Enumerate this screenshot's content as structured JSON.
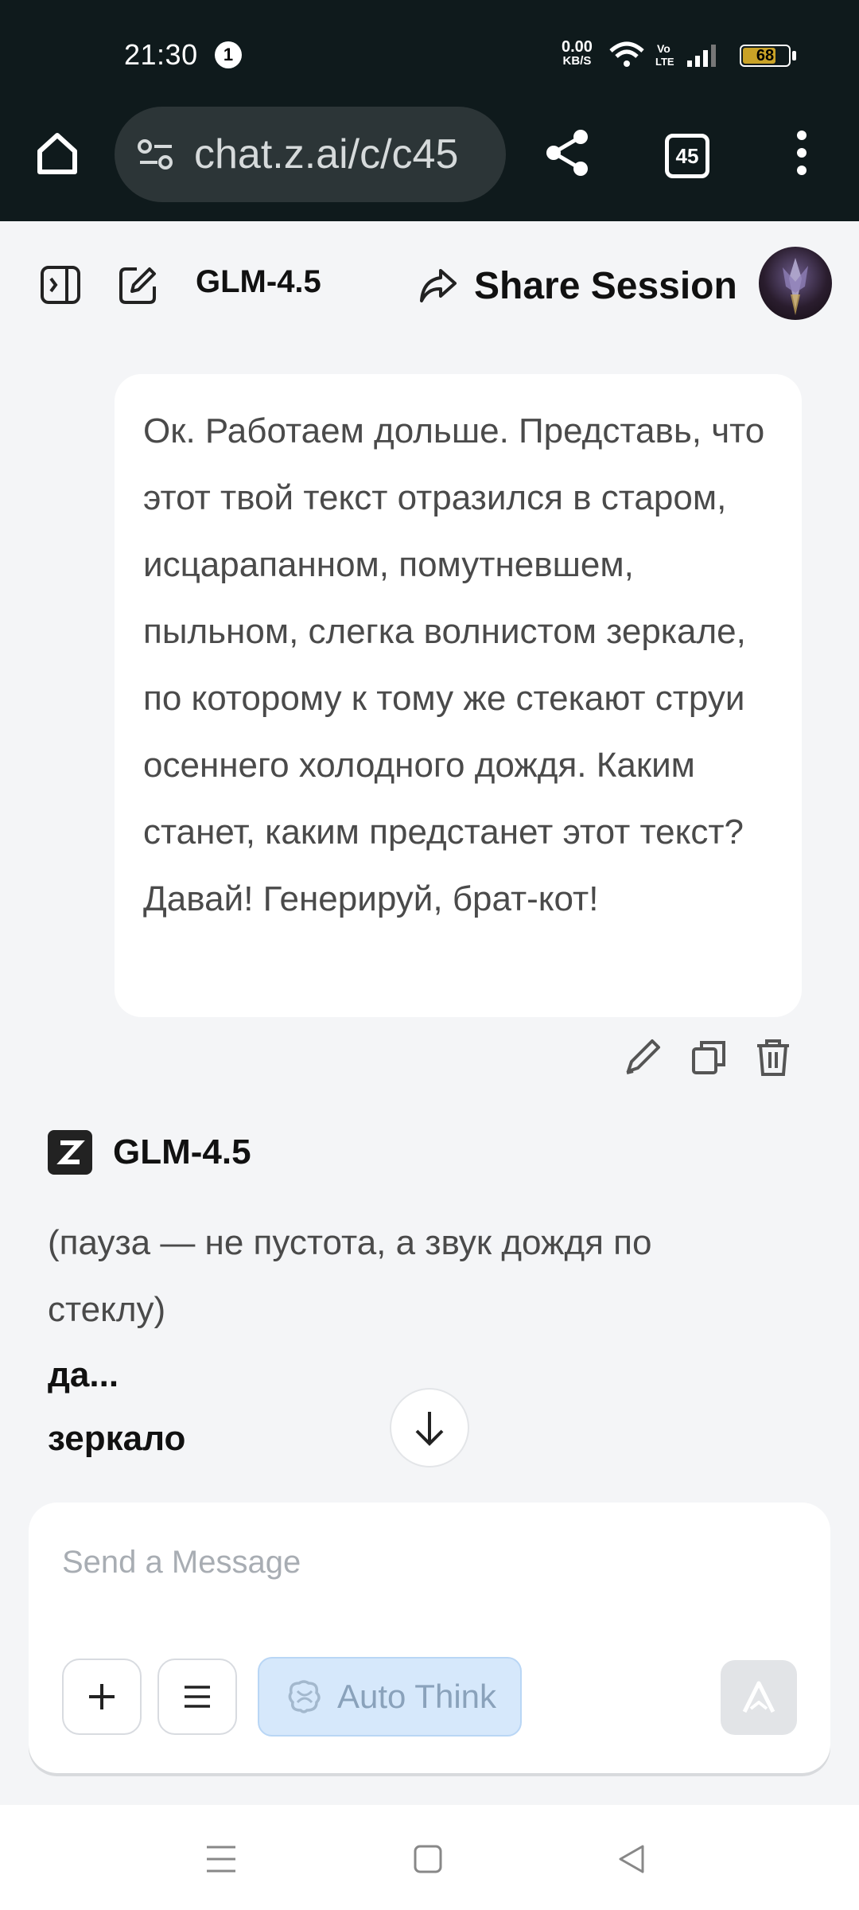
{
  "status_bar": {
    "time": "21:30",
    "notification_count": "1",
    "net_speed_value": "0.00",
    "net_speed_unit": "KB/S",
    "volte_label": "Vo LTE",
    "battery_level": "68"
  },
  "browser": {
    "url": "chat.z.ai/c/c45",
    "tab_count": "45"
  },
  "header": {
    "model_name": "GLM-4.5",
    "share_label": "Share Session"
  },
  "user_message": {
    "text": "Ок. Работаем дольше. Представь, что этот твой текст отразился в старом, исцарапанном, помутневшем, пыльном, слегка волнистом зеркале, по которому к тому же стекают струи осеннего холодного дождя. Каким станет, каким предстанет этот текст? Давай! Генерируй, брат-кот!"
  },
  "assistant": {
    "name": "GLM-4.5",
    "lines": [
      "(пауза — не пустота, а звук дождя по стеклу)"
    ],
    "bold_lines": [
      "да...",
      "зеркало"
    ]
  },
  "composer": {
    "placeholder": "Send a Message",
    "auto_think_label": "Auto Think"
  },
  "colors": {
    "browser_bg": "#0f1a1c",
    "page_bg": "#f4f5f7",
    "auto_think_bg": "#d6e8fb",
    "battery": "#c9a227"
  }
}
